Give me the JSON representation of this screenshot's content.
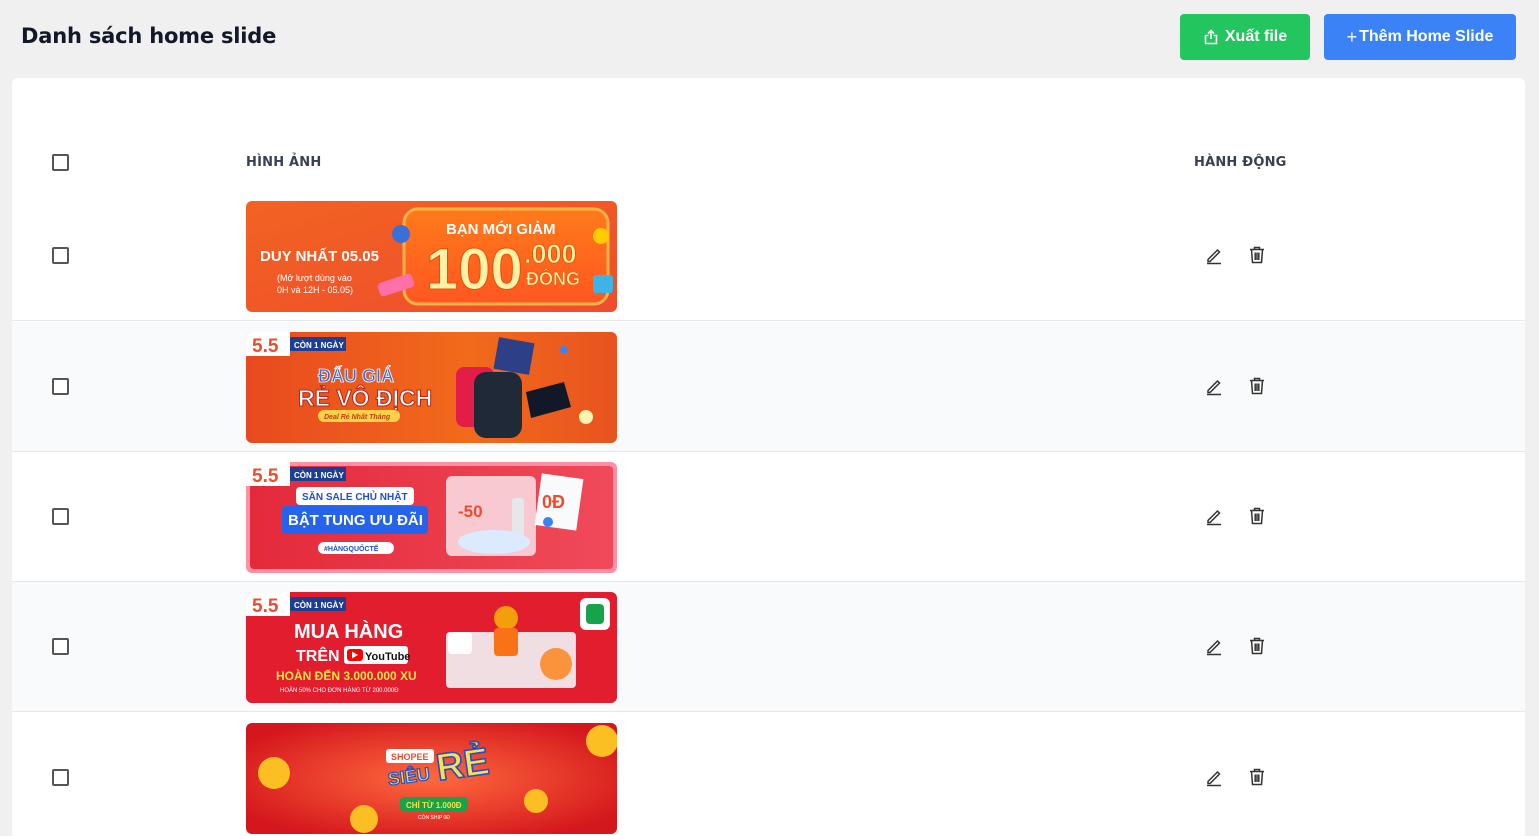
{
  "header": {
    "title": "Danh sách home slide",
    "export_label": "Xuất file",
    "add_label": "Thêm Home Slide",
    "export_color": "#22c55e",
    "add_color": "#3b82f6"
  },
  "table": {
    "columns": [
      "HÌNH ẢNH",
      "HÀNH ĐỘNG"
    ],
    "rows": [
      {
        "image_icon": "banner-image",
        "b1": "BẠN MỚI GIẢM",
        "b2": "100",
        "b3": ".000",
        "b4": "ĐỒNG",
        "b5": "DUY NHẤT 05.05",
        "b6": "(Mở lượt dùng vào",
        "b7": "0H và 12H - 05.05)"
      },
      {
        "image_icon": "banner-image",
        "b1": "5.5",
        "b2": "CÒN 1 NGÀY",
        "b3": "ĐẤU GIÁ",
        "b4": "RẺ VÔ ĐỊCH",
        "b5": "Deal Rẻ Nhất Tháng"
      },
      {
        "image_icon": "banner-image",
        "b1": "5.5",
        "b2": "CÒN 1 NGÀY",
        "b3": "SĂN SALE CHỦ NHẬT",
        "b4": "BẬT TUNG ƯU ĐÃI",
        "b5": "#HÀNGQUỐCTẾ",
        "b6": "-50",
        "b7": "0Đ"
      },
      {
        "image_icon": "banner-image",
        "b1": "5.5",
        "b2": "CÒN 1 NGÀY",
        "b3": "MUA HÀNG",
        "b4": "TRÊN",
        "b5": "YouTube",
        "b6": "HOÀN ĐẾN 3.000.000 XU",
        "b7": "HOÀN 50% CHO ĐƠN HÀNG TỪ 200.000Đ"
      },
      {
        "image_icon": "banner-image",
        "b1": "SHOPEE",
        "b2": "SIÊU",
        "b3": "RẺ",
        "b4": "CHỈ TỪ 1.000Đ",
        "b5": "CÒN SHIP 0Đ"
      }
    ]
  }
}
